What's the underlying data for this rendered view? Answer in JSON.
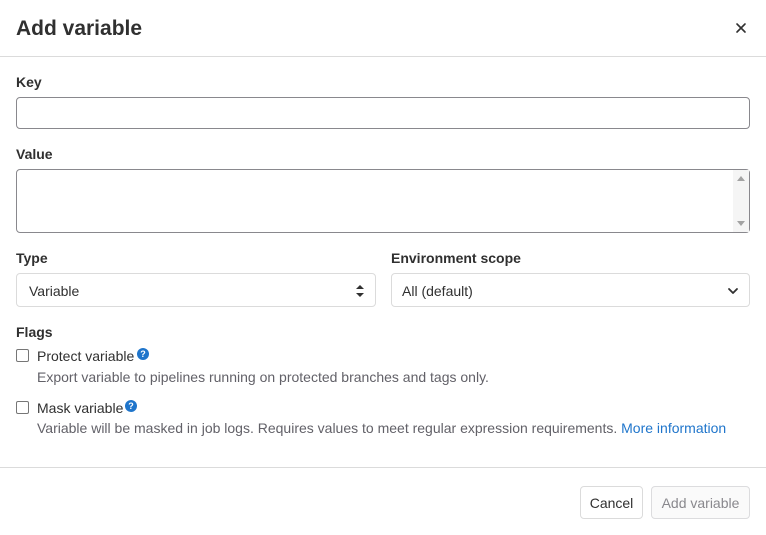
{
  "dialog": {
    "title": "Add variable",
    "close_icon": "close-icon"
  },
  "fields": {
    "key_label": "Key",
    "key_value": "",
    "value_label": "Value",
    "value_value": "",
    "type_label": "Type",
    "type_selected": "Variable",
    "env_label": "Environment scope",
    "env_selected": "All (default)"
  },
  "flags": {
    "label": "Flags",
    "protect": {
      "label": "Protect variable",
      "checked": false,
      "description": "Export variable to pipelines running on protected branches and tags only."
    },
    "mask": {
      "label": "Mask variable",
      "checked": false,
      "description": "Variable will be masked in job logs. Requires values to meet regular expression requirements.",
      "link": "More information"
    },
    "help_icon": "question-circle-icon"
  },
  "footer": {
    "cancel_label": "Cancel",
    "add_label": "Add variable"
  },
  "colors": {
    "link": "#1f75cb",
    "disabled_text": "#89888d"
  }
}
